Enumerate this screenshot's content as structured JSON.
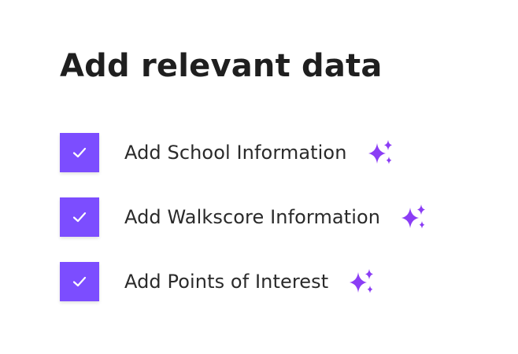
{
  "heading": "Add relevant data",
  "accent_color": "#7c4dff",
  "options": [
    {
      "label": "Add School Information",
      "checked": true,
      "icon": "sparkles-icon"
    },
    {
      "label": "Add Walkscore Information",
      "checked": true,
      "icon": "sparkles-icon"
    },
    {
      "label": "Add Points of Interest",
      "checked": true,
      "icon": "sparkles-icon"
    }
  ]
}
